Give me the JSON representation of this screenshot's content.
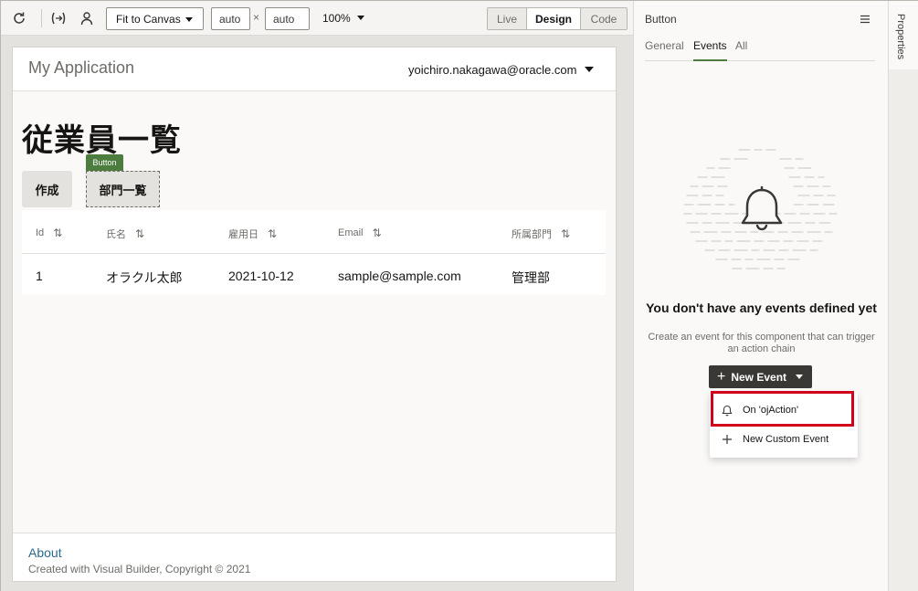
{
  "toolbar": {
    "icons": [
      "refresh-icon",
      "variable-icon",
      "user-icon"
    ],
    "fit_label": "Fit to Canvas",
    "width_value": "auto",
    "times_symbol": "×",
    "height_value": "auto",
    "zoom_label": "100%",
    "modes": [
      {
        "label": "Live",
        "active": false
      },
      {
        "label": "Design",
        "active": true
      },
      {
        "label": "Code",
        "active": false
      }
    ]
  },
  "app": {
    "title": "My Application",
    "user_email": "yoichiro.nakagawa@oracle.com",
    "heading": "従業員一覧",
    "create_button": "作成",
    "dept_button": "部門一覧",
    "selected_tag": "Button",
    "table": {
      "headers": [
        "Id",
        "氏名",
        "雇用日",
        "Email",
        "所属部門"
      ],
      "rows": [
        [
          "1",
          "オラクル太郎",
          "2021-10-12",
          "sample@sample.com",
          "管理部"
        ]
      ]
    },
    "footer": {
      "link": "About",
      "text": "Created with Visual Builder, Copyright © 2021"
    }
  },
  "panel": {
    "title": "Button",
    "tabs": [
      {
        "label": "General",
        "active": false
      },
      {
        "label": "Events",
        "active": true
      },
      {
        "label": "All",
        "active": false
      }
    ],
    "empty_title": "You don't have any events defined yet",
    "empty_desc": "Create an event for this component that can trigger an action chain",
    "new_event_label": "New Event",
    "dropdown": [
      {
        "label": "On 'ojAction'",
        "icon": "bell-icon"
      },
      {
        "label": "New Custom Event",
        "icon": "plus-icon"
      }
    ],
    "side_tab": "Properties"
  },
  "colors": {
    "accent_green": "#4c7d3f",
    "highlight_red": "#d0021b",
    "dark_button": "#3a3835",
    "link_blue": "#2b6c8f"
  }
}
